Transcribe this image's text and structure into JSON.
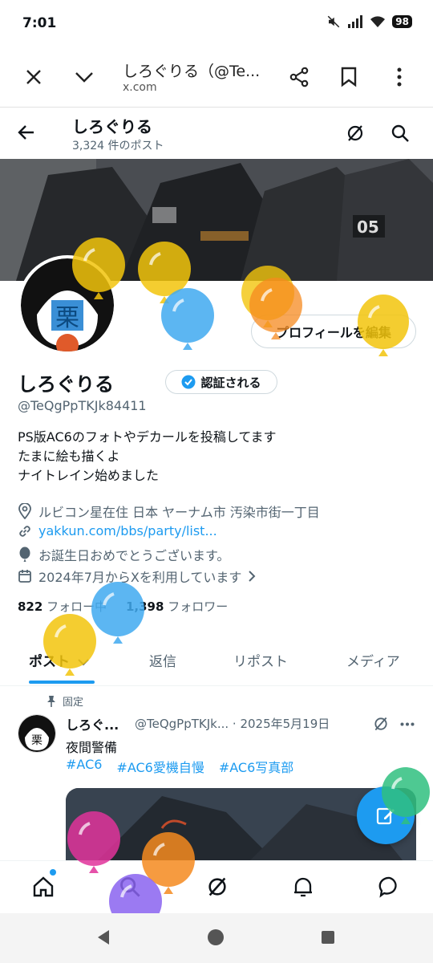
{
  "status": {
    "time": "7:01",
    "battery": "98"
  },
  "browser": {
    "title": "しろぐりる（@Te...",
    "url": "x.com"
  },
  "header": {
    "name": "しろぐりる",
    "post_count": "3,324 件のポスト"
  },
  "profile": {
    "edit_label": "プロフィールを編集",
    "name": "しろぐりる",
    "verify_label": "認証される",
    "handle": "@TeQgPpTKJk84411",
    "bio": [
      "PS版AC6のフォトやデカールを投稿してます",
      "たまに絵も描くよ",
      "ナイトレイン始めました"
    ],
    "location": "ルビコン星在住 日本 ヤーナム市 汚染市街一丁目",
    "website": "yakkun.com/bbs/party/list...",
    "birthday": "お誕生日おめでとうございます。",
    "joined": "2024年7月からXを利用しています",
    "following_count": "822",
    "following_label": "フォロー中",
    "followers_count": "1,398",
    "followers_label": "フォロワー"
  },
  "tabs": [
    {
      "label": "ポスト"
    },
    {
      "label": "返信"
    },
    {
      "label": "リポスト"
    },
    {
      "label": "メディア"
    }
  ],
  "pinned_post": {
    "pinned_label": "固定",
    "name": "しろぐ...",
    "handle_date": "@TeQgPpTKJk... · 2025年5月19日",
    "text": "夜間警備",
    "tags": [
      "#AC6",
      "#AC6愛機自慢",
      "#AC6写真部"
    ]
  },
  "colors": {
    "accent": "#1d9bf0",
    "text": "#0f1419",
    "muted": "#536471"
  },
  "icons": [
    "close-icon",
    "chevron-down-icon",
    "share-icon",
    "bookmark-icon",
    "more-icon",
    "back-icon",
    "grok-icon",
    "search-icon",
    "location-icon",
    "link-icon",
    "balloon-icon",
    "calendar-icon",
    "pin-icon",
    "compose-icon",
    "home-icon",
    "bell-icon",
    "message-icon"
  ]
}
